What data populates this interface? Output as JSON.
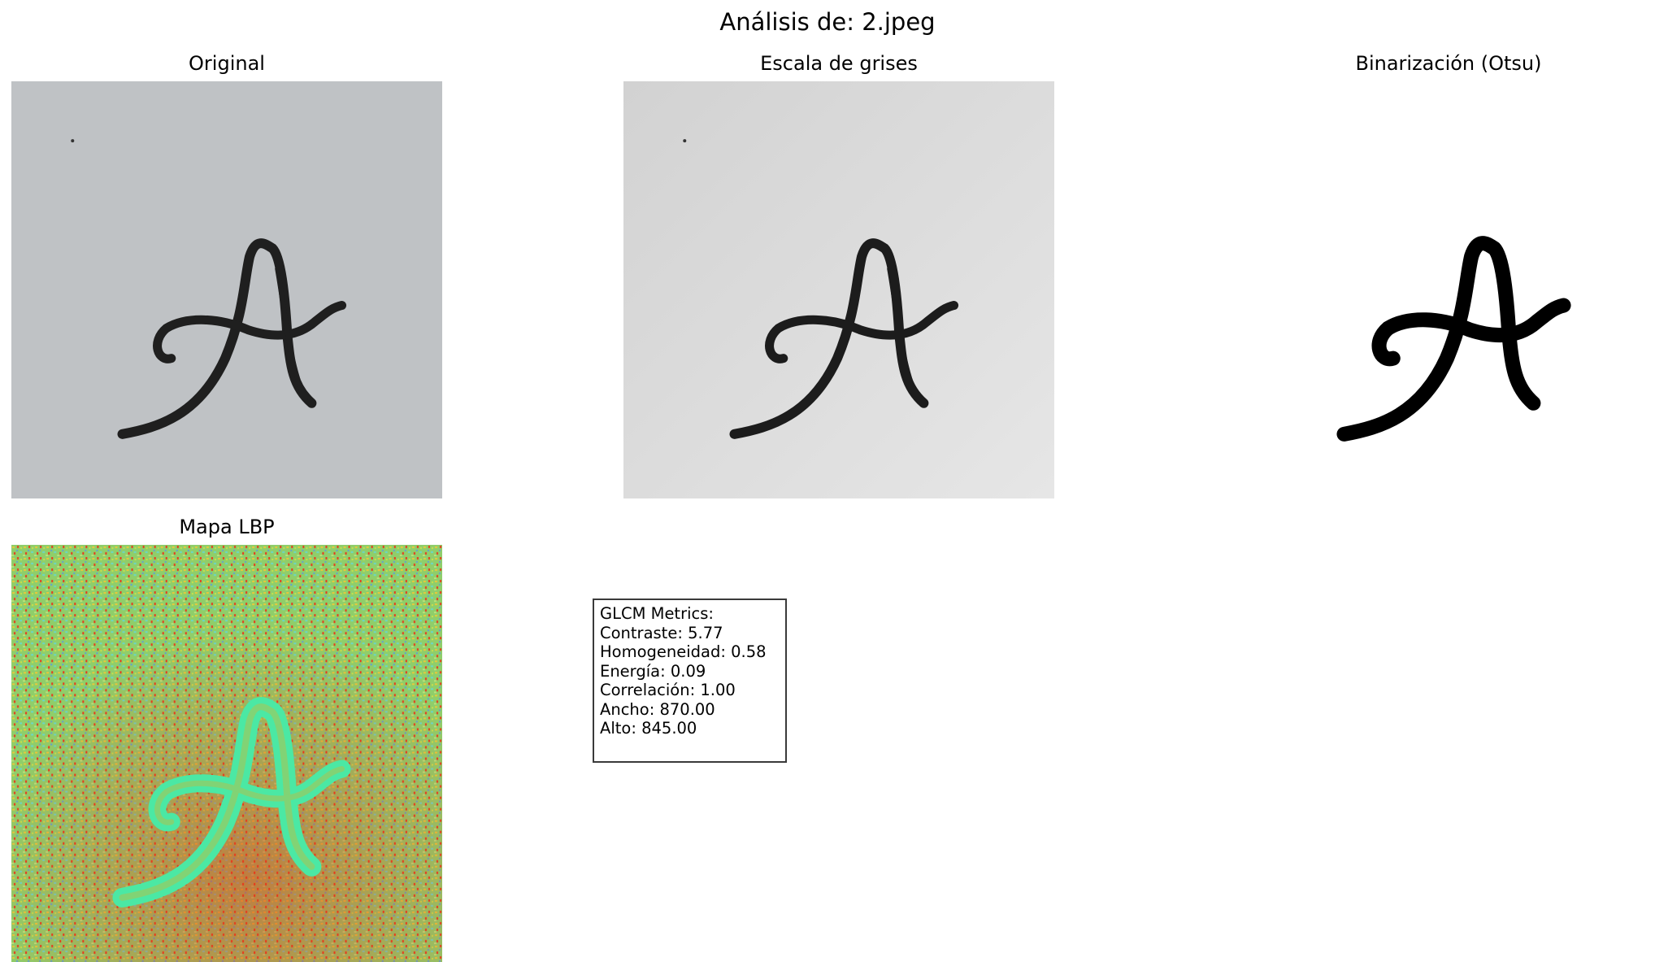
{
  "figure": {
    "title": "Análisis de: 2.jpeg"
  },
  "panels": {
    "original": {
      "title": "Original"
    },
    "grayscale": {
      "title": "Escala de grises"
    },
    "binarized": {
      "title": "Binarización (Otsu)"
    },
    "lbp": {
      "title": "Mapa LBP"
    }
  },
  "glcm": {
    "heading": "GLCM Metrics:",
    "lines": [
      "Contraste: 5.77",
      "Homogeneidad: 0.58",
      "Energía: 0.09",
      "Correlación: 1.00",
      "Ancho: 870.00",
      "Alto: 845.00"
    ]
  },
  "colors": {
    "paper_original": "#c3c5c8",
    "paper_gray": "#dadada",
    "ink": "#1f1f1f",
    "lbp_background": "#8fce6a",
    "lbp_noise": "#e83a1c",
    "lbp_stroke": "#4be8a4"
  }
}
